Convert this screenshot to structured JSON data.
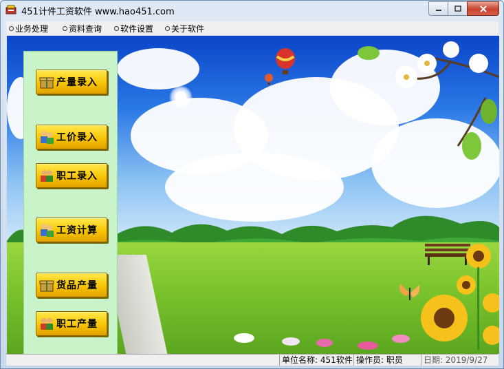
{
  "window": {
    "title": "451计件工资软件 www.hao451.com"
  },
  "menu": {
    "items": [
      {
        "label": "业务处理"
      },
      {
        "label": "资料查询"
      },
      {
        "label": "软件设置"
      },
      {
        "label": "关于软件"
      }
    ]
  },
  "sidebar": {
    "buttons": [
      {
        "label": "产量录入",
        "icon": "gift-icon"
      },
      {
        "label": "工价录入",
        "icon": "people-icon"
      },
      {
        "label": "职工录入",
        "icon": "user-group-icon"
      },
      {
        "label": "工资计算",
        "icon": "people-icon"
      },
      {
        "label": "货品产量",
        "icon": "gift-icon"
      },
      {
        "label": "职工产量",
        "icon": "user-group-icon"
      }
    ]
  },
  "status": {
    "unit": "单位名称: 451软件",
    "operator": "操作员: 职员",
    "date": "日期: 2019/9/27"
  },
  "colors": {
    "sidebar_bg": "#c9f3c9",
    "button_yellow": "#f6c200"
  }
}
